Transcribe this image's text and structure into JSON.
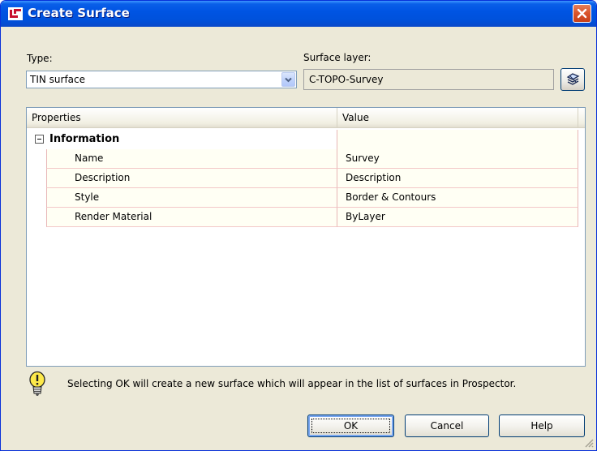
{
  "window": {
    "title": "Create Surface"
  },
  "type": {
    "label": "Type:",
    "value": "TIN surface"
  },
  "surface_layer": {
    "label": "Surface layer:",
    "value": "C-TOPO-Survey"
  },
  "grid": {
    "headers": [
      "Properties",
      "Value"
    ],
    "category": "Information",
    "rows": [
      {
        "property": "Name",
        "value": "Survey"
      },
      {
        "property": "Description",
        "value": "Description"
      },
      {
        "property": "Style",
        "value": "Border & Contours"
      },
      {
        "property": "Render Material",
        "value": "ByLayer"
      }
    ]
  },
  "info_message": "Selecting OK will create a new surface which will appear in the list of surfaces in Prospector.",
  "buttons": {
    "ok": "OK",
    "cancel": "Cancel",
    "help": "Help"
  },
  "colors": {
    "titlebar": "#0054e3",
    "dialog_bg": "#ece9d8",
    "close": "#d9542a",
    "row_bg": "#fffff4"
  }
}
